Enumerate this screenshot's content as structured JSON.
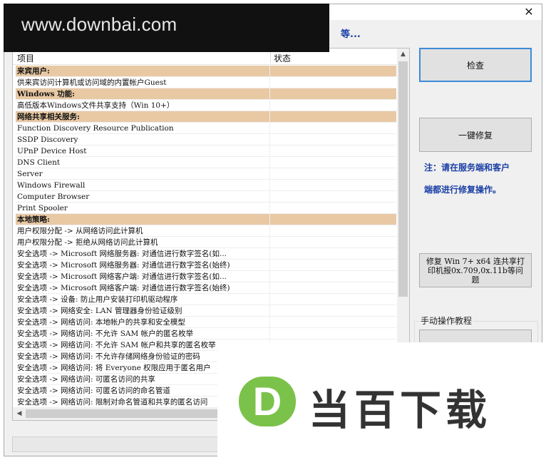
{
  "watermark": {
    "site": "www.downbai.com",
    "brand": "当百下载",
    "badge_letter": "D"
  },
  "titlebar": {
    "close_glyph": "✕",
    "partial_heading": "等..."
  },
  "list": {
    "columns": [
      "项目",
      "状态"
    ],
    "rows": [
      {
        "label": "来宾用户:",
        "status": "",
        "section": true
      },
      {
        "label": "供来宾访问计算机或访问域的内置帐户Guest",
        "status": "",
        "section": false
      },
      {
        "label": "Windows 功能:",
        "status": "",
        "section": true
      },
      {
        "label": "高低版本Windows文件共享支持（Win 10+）",
        "status": "",
        "section": false
      },
      {
        "label": "网络共享相关服务:",
        "status": "",
        "section": true
      },
      {
        "label": "Function Discovery Resource Publication",
        "status": "",
        "section": false
      },
      {
        "label": "SSDP Discovery",
        "status": "",
        "section": false
      },
      {
        "label": "UPnP Device Host",
        "status": "",
        "section": false
      },
      {
        "label": "DNS Client",
        "status": "",
        "section": false
      },
      {
        "label": "Server",
        "status": "",
        "section": false
      },
      {
        "label": "Windows Firewall",
        "status": "",
        "section": false
      },
      {
        "label": "Computer Browser",
        "status": "",
        "section": false
      },
      {
        "label": "Print Spooler",
        "status": "",
        "section": false
      },
      {
        "label": "本地策略:",
        "status": "",
        "section": true
      },
      {
        "label": "用户权限分配 -> 从网络访问此计算机",
        "status": "",
        "section": false
      },
      {
        "label": "用户权限分配 -> 拒绝从网络访问此计算机",
        "status": "",
        "section": false
      },
      {
        "label": "安全选项 -> Microsoft 网络服务器: 对通信进行数字签名(如...",
        "status": "",
        "section": false
      },
      {
        "label": "安全选项 -> Microsoft 网络服务器: 对通信进行数字签名(始终)",
        "status": "",
        "section": false
      },
      {
        "label": "安全选项 -> Microsoft 网络客户端: 对通信进行数字签名(如...",
        "status": "",
        "section": false
      },
      {
        "label": "安全选项 -> Microsoft 网络客户端: 对通信进行数字签名(始终)",
        "status": "",
        "section": false
      },
      {
        "label": "安全选项 -> 设备: 防止用户安装打印机驱动程序",
        "status": "",
        "section": false
      },
      {
        "label": "安全选项 -> 网络安全: LAN 管理器身份验证级别",
        "status": "",
        "section": false
      },
      {
        "label": "安全选项 -> 网络访问: 本地帐户的共享和安全模型",
        "status": "",
        "section": false
      },
      {
        "label": "安全选项 -> 网络访问: 不允许 SAM 帐户的匿名枚举",
        "status": "",
        "section": false
      },
      {
        "label": "安全选项 -> 网络访问: 不允许 SAM 帐户和共享的匿名枚举",
        "status": "",
        "section": false
      },
      {
        "label": "安全选项 -> 网络访问: 不允许存储网络身份验证的密码",
        "status": "",
        "section": false
      },
      {
        "label": "安全选项 -> 网络访问: 将 Everyone 权限应用于匿名用户",
        "status": "",
        "section": false
      },
      {
        "label": "安全选项 -> 网络访问: 可匿名访问的共享",
        "status": "",
        "section": false
      },
      {
        "label": "安全选项 -> 网络访问: 可匿名访问的命名管道",
        "status": "",
        "section": false
      },
      {
        "label": "安全选项 -> 网络访问: 限制对命名管道和共享的匿名访问",
        "status": "",
        "section": false
      }
    ]
  },
  "actions": {
    "check": "检查",
    "fix_all": "一键修复",
    "note_line1": "注：请在服务端和客户",
    "note_line2": "端都进行修复操作。",
    "printer_fix": "修复 Win 7+ x64 连共享打印机报0x.709,0x.11b等问题",
    "manual_group": "手动操作教程"
  }
}
